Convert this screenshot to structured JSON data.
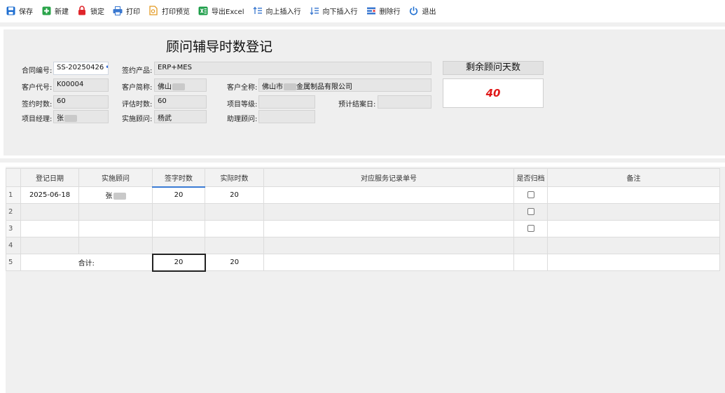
{
  "toolbar": {
    "items": [
      {
        "label": "保存",
        "icon": "save-icon",
        "color": "#1f6fd1"
      },
      {
        "label": "新建",
        "icon": "new-icon",
        "color": "#2aa44a"
      },
      {
        "label": "锁定",
        "icon": "lock-icon",
        "color": "#e0262b"
      },
      {
        "label": "打印",
        "icon": "print-icon",
        "color": "#3a78d0"
      },
      {
        "label": "打印预览",
        "icon": "print-preview-icon",
        "color": "#e39a22"
      },
      {
        "label": "导出Excel",
        "icon": "excel-icon",
        "color": "#1e9e4a"
      },
      {
        "label": "向上插入行",
        "icon": "insert-up-icon",
        "color": "#3a78d0"
      },
      {
        "label": "向下插入行",
        "icon": "insert-down-icon",
        "color": "#3a78d0"
      },
      {
        "label": "删除行",
        "icon": "delete-row-icon",
        "color": "#3a78d0"
      },
      {
        "label": "退出",
        "icon": "power-icon",
        "color": "#1f6fd1"
      }
    ]
  },
  "form": {
    "title": "顾问辅导时数登记",
    "contract_no": {
      "label": "合同编号:",
      "value": "SS-20250426",
      "more": "•••"
    },
    "product": {
      "label": "签约产品:",
      "value": "ERP+MES"
    },
    "customer_code": {
      "label": "客户代号:",
      "value": "K00004"
    },
    "customer_short": {
      "label": "客户简称:",
      "value": "佛山"
    },
    "customer_full": {
      "label": "客户全称:",
      "value_prefix": "佛山市",
      "value_suffix": "金属制品有限公司"
    },
    "contract_hours": {
      "label": "签约时数:",
      "value": "60"
    },
    "estimated_hours": {
      "label": "评估时数:",
      "value": "60"
    },
    "project_level": {
      "label": "项目等级:",
      "value": ""
    },
    "expected_close": {
      "label": "预计结案日:",
      "value": ""
    },
    "project_manager": {
      "label": "项目经理:",
      "value": "张"
    },
    "consultant": {
      "label": "实施顾问:",
      "value": "杨武"
    },
    "assistant": {
      "label": "助理顾问:",
      "value": ""
    },
    "remaining": {
      "label": "剩余顾问天数",
      "value": "40"
    }
  },
  "grid": {
    "columns": [
      "登记日期",
      "实施顾问",
      "签字时数",
      "实际时数",
      "对应服务记录单号",
      "是否归档",
      "备注"
    ],
    "rows": [
      {
        "no": "1",
        "date": "2025-06-18",
        "consultant": "张",
        "signed": "20",
        "actual": "20",
        "record": "",
        "archived": false,
        "note": ""
      },
      {
        "no": "2",
        "date": "",
        "consultant": "",
        "signed": "",
        "actual": "",
        "record": "",
        "archived": false,
        "note": ""
      },
      {
        "no": "3",
        "date": "",
        "consultant": "",
        "signed": "",
        "actual": "",
        "record": "",
        "archived": false,
        "note": ""
      },
      {
        "no": "4",
        "date": "",
        "consultant": "",
        "signed": "",
        "actual": "",
        "record": "",
        "archived": null,
        "note": ""
      }
    ],
    "total": {
      "no": "5",
      "label": "合计:",
      "signed": "20",
      "actual": "20"
    }
  }
}
